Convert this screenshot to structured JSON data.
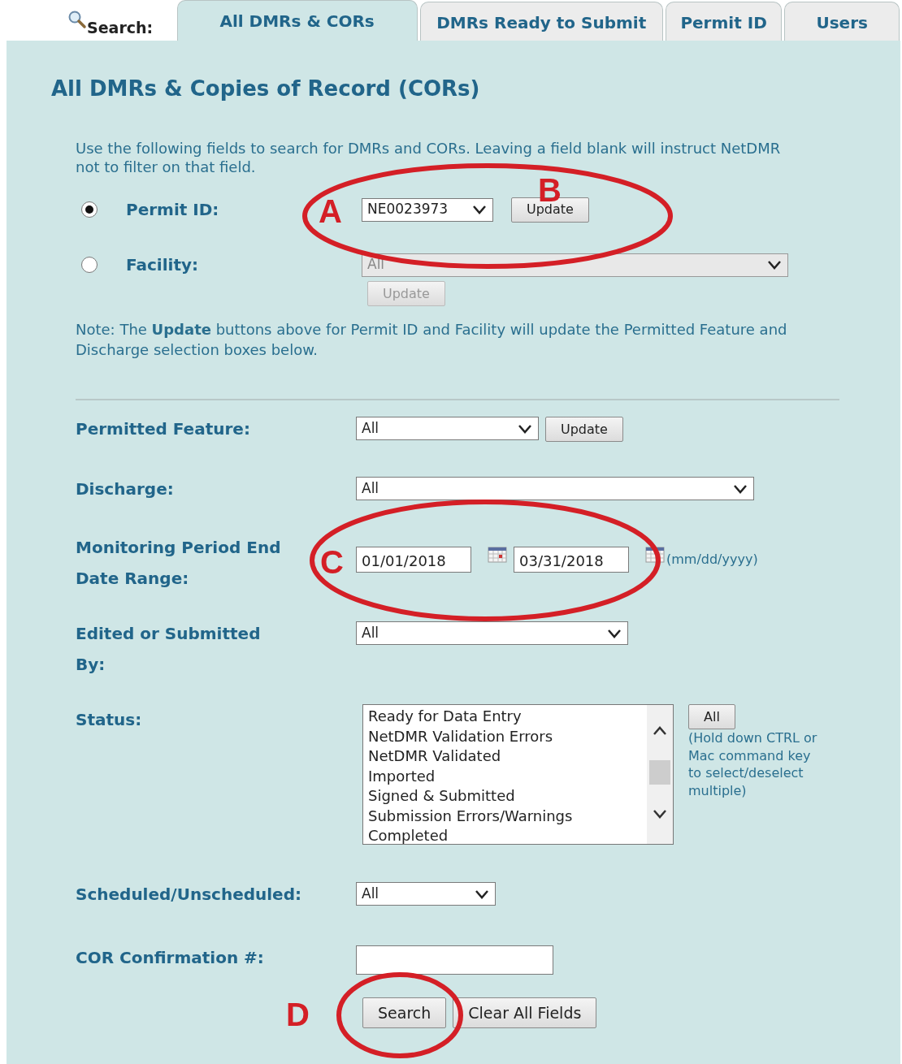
{
  "search_label": "Search:",
  "tabs": [
    {
      "label": "All DMRs & CORs",
      "selected": true
    },
    {
      "label": "DMRs Ready to Submit",
      "selected": false
    },
    {
      "label": "Permit ID",
      "selected": false
    },
    {
      "label": "Users",
      "selected": false
    }
  ],
  "heading": "All DMRs & Copies of Record (CORs)",
  "intro": "Use the following fields to search for DMRs and CORs. Leaving a field blank will instruct NetDMR not to filter on that field.",
  "source_options": [
    {
      "label": "Permit ID:",
      "selected": true,
      "value": "NE0023973",
      "button": "Update",
      "disabled": false
    },
    {
      "label": "Facility:",
      "selected": false,
      "value": "All",
      "button": "Update",
      "disabled": true
    }
  ],
  "note": "Note: The **Update** buttons above for Permit ID and Facility will update the Permitted Feature and Discharge selection boxes below.",
  "fields": [
    {
      "kind": "select",
      "label": "Permitted Feature:",
      "value": "All",
      "button": "Update"
    },
    {
      "kind": "select",
      "label": "Discharge:",
      "value": "All"
    },
    {
      "kind": "date_range",
      "label": "Monitoring Period End Date Range:",
      "from": "01/01/2018",
      "to": "03/31/2018",
      "hint": "(mm/dd/yyyy)"
    },
    {
      "kind": "select",
      "label": "Edited or Submitted By:",
      "value": "All"
    },
    {
      "kind": "listbox",
      "label": "Status:",
      "options": [
        "Ready for Data Entry",
        "NetDMR Validation Errors",
        "NetDMR Validated",
        "Imported",
        "Signed & Submitted",
        "Submission Errors/Warnings",
        "Completed"
      ],
      "button": "All",
      "hint": "(Hold down CTRL or Mac command key to select/deselect multiple)"
    },
    {
      "kind": "select",
      "label": "Scheduled/Unscheduled:",
      "value": "All"
    },
    {
      "kind": "text",
      "label": "COR Confirmation #:"
    }
  ],
  "buttons": [
    "Search",
    "Clear All Fields"
  ],
  "annotations": [
    {
      "letter": "A"
    },
    {
      "letter": "B"
    },
    {
      "letter": "C"
    },
    {
      "letter": "D"
    }
  ]
}
